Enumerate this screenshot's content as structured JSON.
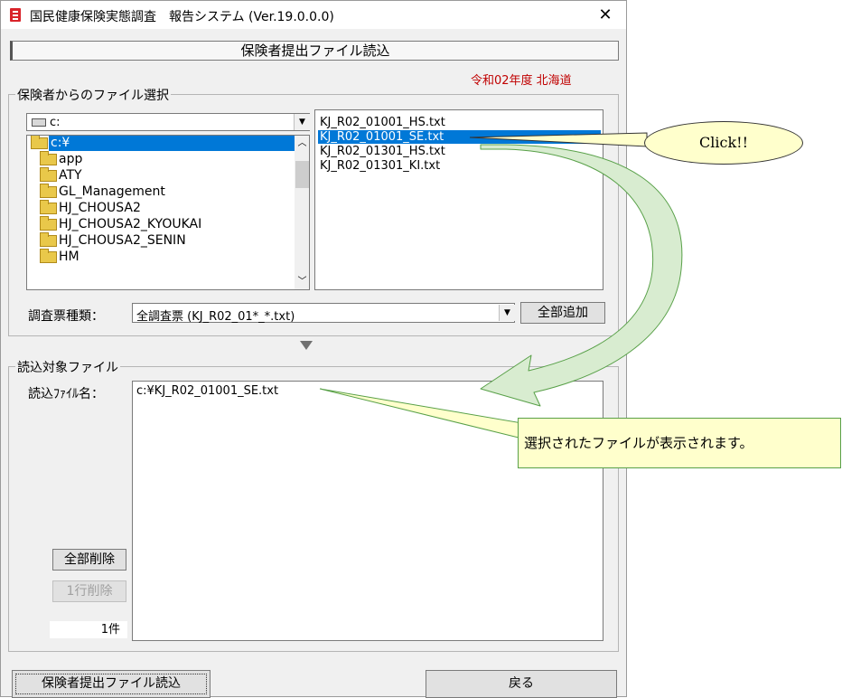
{
  "window": {
    "title": "国民健康保険実態調査　報告システム (Ver.19.0.0.0)",
    "close_glyph": "✕"
  },
  "header": {
    "title": "保険者提出ファイル読込",
    "fiscal_info": "令和02年度 北海道"
  },
  "file_select_group": {
    "label": "保険者からのファイル選択",
    "drive": "c:",
    "dirs": [
      {
        "label": "c:¥",
        "selected": true
      },
      {
        "label": "app"
      },
      {
        "label": "ATY"
      },
      {
        "label": "GL_Management"
      },
      {
        "label": "HJ_CHOUSA2"
      },
      {
        "label": "HJ_CHOUSA2_KYOUKAI"
      },
      {
        "label": "HJ_CHOUSA2_SENIN"
      },
      {
        "label": "HM"
      }
    ],
    "files": [
      {
        "name": "KJ_R02_01001_HS.txt"
      },
      {
        "name": "KJ_R02_01001_SE.txt",
        "selected": true
      },
      {
        "name": "KJ_R02_01301_HS.txt"
      },
      {
        "name": "KJ_R02_01301_KI.txt"
      }
    ],
    "survey_type_label": "調査票種類：",
    "survey_type_value": "全調査票 (KJ_R02_01*_*.txt)",
    "add_all_button": "全部追加"
  },
  "read_target_group": {
    "label": "読込対象ファイル",
    "file_name_label": "読込ﾌｧｲﾙ名：",
    "file_path": "c:¥KJ_R02_01001_SE.txt",
    "delete_all_button": "全部削除",
    "delete_row_button": "1行削除",
    "count": "1件"
  },
  "footer": {
    "read_button": "保険者提出ファイル読込",
    "back_button": "戻る"
  },
  "annotations": {
    "click_callout": "Click!!",
    "display_note": "選択されたファイルが表示されます。"
  },
  "colors": {
    "selection": "#0078d7",
    "fiscal_text": "#c00000",
    "callout_fill": "#ffffcc",
    "arrow_fill": "#d8ecd0",
    "arrow_stroke": "#58a048"
  }
}
